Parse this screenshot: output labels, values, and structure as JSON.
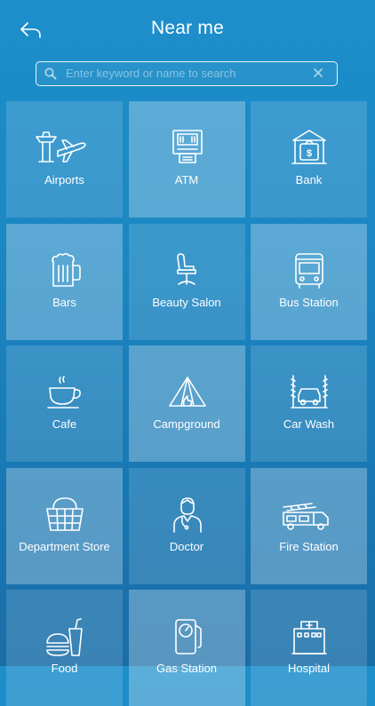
{
  "header": {
    "title": "Near me",
    "back_icon": "back-arrow-icon"
  },
  "search": {
    "placeholder": "Enter keyword or name to search",
    "value": "",
    "icon": "search-icon",
    "clear_icon": "clear-icon"
  },
  "categories": [
    {
      "label": "Airports",
      "icon": "airport-icon"
    },
    {
      "label": "ATM",
      "icon": "atm-icon"
    },
    {
      "label": "Bank",
      "icon": "bank-icon"
    },
    {
      "label": "Bars",
      "icon": "beer-mug-icon"
    },
    {
      "label": "Beauty Salon",
      "icon": "salon-chair-icon"
    },
    {
      "label": "Bus Station",
      "icon": "bus-icon"
    },
    {
      "label": "Cafe",
      "icon": "coffee-cup-icon"
    },
    {
      "label": "Campground",
      "icon": "tent-icon"
    },
    {
      "label": "Car Wash",
      "icon": "car-wash-icon"
    },
    {
      "label": "Department Store",
      "icon": "shopping-basket-icon"
    },
    {
      "label": "Doctor",
      "icon": "doctor-icon"
    },
    {
      "label": "Fire Station",
      "icon": "fire-truck-icon"
    },
    {
      "label": "Food",
      "icon": "burger-drink-icon"
    },
    {
      "label": "Gas Station",
      "icon": "fuel-pump-icon"
    },
    {
      "label": "Hospital",
      "icon": "hospital-icon"
    }
  ],
  "colors": {
    "background": "#1d8fcb",
    "foreground": "#ffffff"
  }
}
